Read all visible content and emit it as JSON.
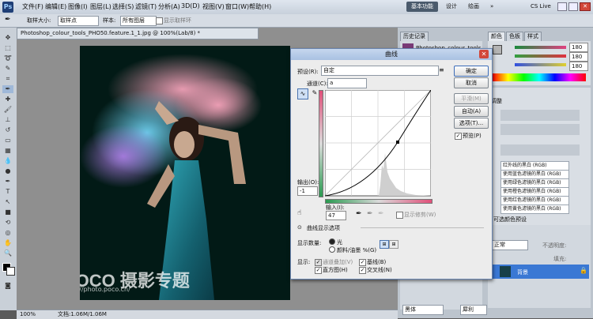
{
  "menubar": {
    "logo": "Ps",
    "items": [
      "文件(F)",
      "编辑(E)",
      "图像(I)",
      "图层(L)",
      "选择(S)",
      "滤镜(T)",
      "分析(A)",
      "3D(D)",
      "视图(V)",
      "窗口(W)",
      "帮助(H)"
    ],
    "workspace_active": "基本功能",
    "workspace_design": "设计",
    "workspace_paint": "绘画",
    "workspace_more": "»",
    "cs_live": "CS Live"
  },
  "options": {
    "sample_size_label": "取样大小:",
    "sample_size_value": "取样点",
    "sample_label": "样本:",
    "sample_value": "所有图层",
    "ring_label": "显示取样环"
  },
  "document": {
    "tab_title": "Photoshop_colour_tools_PHO50.feature.1_1.jpg @ 100%(Lab/8) *",
    "watermark_logo": "POCO 摄影专题",
    "watermark_url": "http://photo.poco.cn/",
    "zoom": "100%",
    "doc_info": "文档:1.06M/1.06M"
  },
  "panels": {
    "history_tab": "历史记录",
    "history_item": "Photoshop_colour_tools...",
    "color_tab": "颜色",
    "swatches_tab": "色板",
    "styles_tab": "样式",
    "color_values": [
      "180",
      "180",
      "180"
    ],
    "adjust_label": "调整",
    "presets": [
      "红外线的黑白 (RGB)",
      "使用蓝色滤镜的黑白 (RGB)",
      "使用绿色滤镜的黑白 (RGB)",
      "使用橙色滤镜的黑白 (RGB)",
      "使用红色滤镜的黑白 (RGB)",
      "使用黄色滤镜的黑白 (RGB)"
    ],
    "selective_color": "可选颜色预设",
    "layer_mode": "正常",
    "layer_opacity": "不透明度:",
    "layer_fill": "填充:",
    "layer_name": "背景",
    "char_font": "黑体",
    "char_style": "犀利"
  },
  "curves": {
    "title": "曲线",
    "preset_label": "预设(R):",
    "preset_value": "自定",
    "channel_label": "通道(C):",
    "channel_value": "a",
    "output_label": "输出(O):",
    "output_value": "-1",
    "input_label": "输入(I):",
    "input_value": "47",
    "show_clipping": "显示修剪(W)",
    "display_options": "曲线显示选项",
    "show_amount_label": "显示数量:",
    "light_option": "光",
    "pigment_option": "颜料/油墨 %(G)",
    "show_label": "显示:",
    "channel_overlays": "通道叠加(V)",
    "baseline": "基线(B)",
    "histogram": "直方图(H)",
    "intersection": "交叉线(N)",
    "buttons": {
      "ok": "确定",
      "cancel": "取消",
      "smooth": "平滑(M)",
      "auto": "自动(A)",
      "options": "选项(T)...",
      "preview": "预览(P)"
    }
  }
}
